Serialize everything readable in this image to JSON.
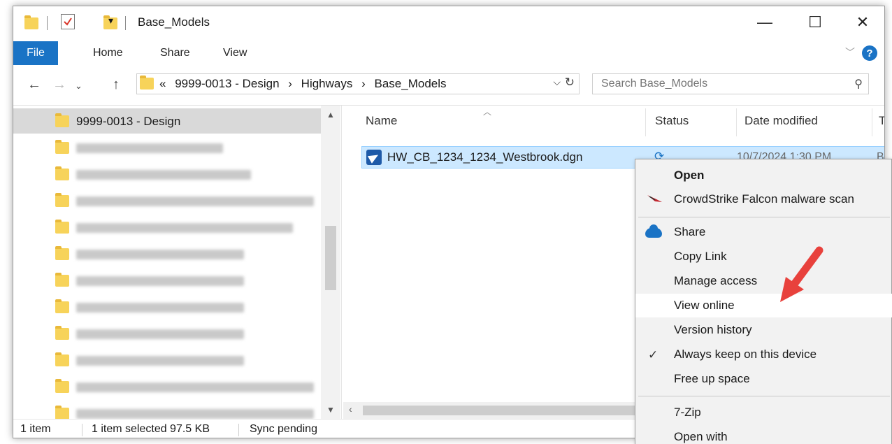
{
  "titlebar": {
    "title": "Base_Models",
    "minimize": "—",
    "maximize": "☐",
    "close": "✕"
  },
  "ribbon": {
    "tabs": [
      "File",
      "Home",
      "Share",
      "View"
    ],
    "chevron": "﹀",
    "help": "?"
  },
  "address": {
    "overflow": "«",
    "crumbs": [
      "9999-0013 - Design",
      "Highways",
      "Base_Models"
    ],
    "separator": "›",
    "search_placeholder": "Search Base_Models"
  },
  "navpane": {
    "selected_folder": "9999-0013 - Design",
    "blurred_folder_count": 11
  },
  "columns": {
    "name": "Name",
    "status": "Status",
    "date_modified": "Date modified",
    "type": "Ty"
  },
  "file": {
    "name": "HW_CB_1234_1234_Westbrook.dgn",
    "date": "10/7/2024 1:30 PM",
    "type": "B"
  },
  "statusbar": {
    "count": "1 item",
    "selected": "1 item selected  97.5 KB",
    "sync": "Sync pending"
  },
  "context_menu": {
    "items": [
      {
        "label": "Open",
        "bold": true
      },
      {
        "label": "CrowdStrike Falcon malware scan"
      },
      {
        "label": "Share"
      },
      {
        "label": "Copy Link"
      },
      {
        "label": "Manage access"
      },
      {
        "label": "View online"
      },
      {
        "label": "Version history"
      },
      {
        "label": "Always keep on this device"
      },
      {
        "label": "Free up space"
      },
      {
        "label": "7-Zip"
      },
      {
        "label": "Open with"
      }
    ],
    "hovered": "View online"
  },
  "colors": {
    "accent": "#1a73c5",
    "selection": "#cce8ff",
    "arrow": "#e8413c"
  }
}
